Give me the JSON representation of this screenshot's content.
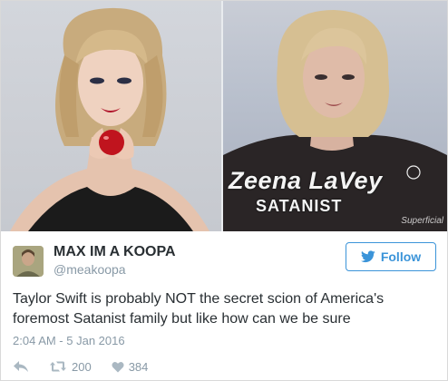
{
  "media": {
    "caption_name": "Zeena LaVey",
    "caption_title": "SATANIST",
    "watermark": "Superficial"
  },
  "author": {
    "display_name": "MAX IM A KOOPA",
    "handle": "@meakoopa"
  },
  "follow_button": {
    "label": "Follow",
    "icon": "twitter-bird-icon"
  },
  "tweet": {
    "text": "Taylor Swift is probably NOT the secret scion of America's foremost Satanist family but like how can we be sure",
    "timestamp": "2:04 AM - 5 Jan 2016"
  },
  "actions": {
    "reply_icon": "reply-icon",
    "retweet_icon": "retweet-icon",
    "retweet_count": "200",
    "like_icon": "heart-icon",
    "like_count": "384"
  },
  "colors": {
    "link_blue": "#3b94d9",
    "text_dark": "#292f33",
    "text_gray": "#8899a6",
    "icon_gray": "#aab8c2"
  }
}
